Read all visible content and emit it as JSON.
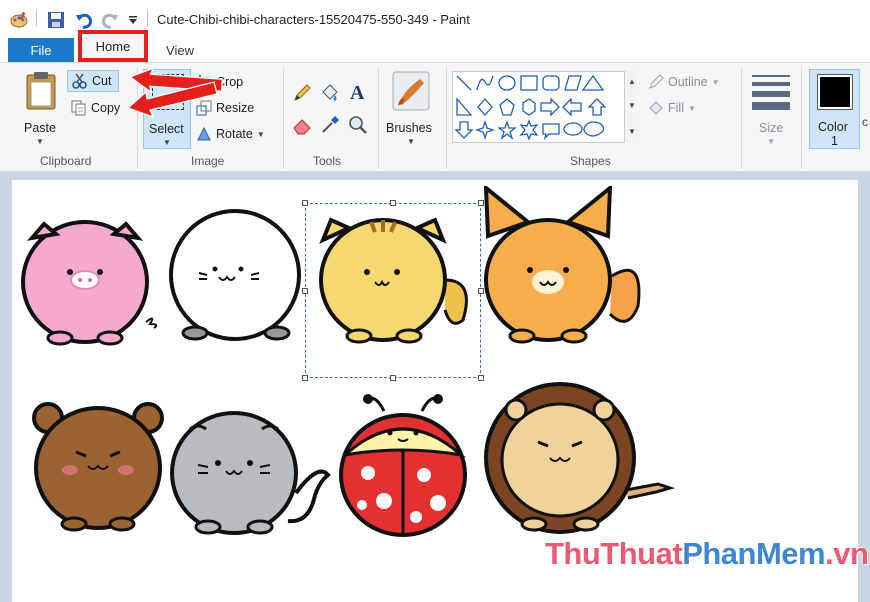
{
  "window": {
    "title": "Cute-Chibi-chibi-characters-15520475-550-349 - Paint"
  },
  "tabs": {
    "file": "File",
    "home": "Home",
    "view": "View"
  },
  "clipboard": {
    "paste": "Paste",
    "cut": "Cut",
    "copy": "Copy",
    "group": "Clipboard"
  },
  "image": {
    "select": "Select",
    "crop": "Crop",
    "resize": "Resize",
    "rotate": "Rotate",
    "group": "Image"
  },
  "tools": {
    "group": "Tools"
  },
  "brushes": {
    "label": "Brushes"
  },
  "shapes": {
    "outline": "Outline",
    "fill": "Fill",
    "group": "Shapes"
  },
  "size": {
    "label": "Size"
  },
  "color": {
    "label": "Color",
    "number": "1"
  },
  "watermark": {
    "part1": "ThuThuat",
    "part2": "PhanMem",
    "part3": ".vn"
  },
  "colors": {
    "accent": "#1979ca",
    "highlight": "#e3201b"
  }
}
